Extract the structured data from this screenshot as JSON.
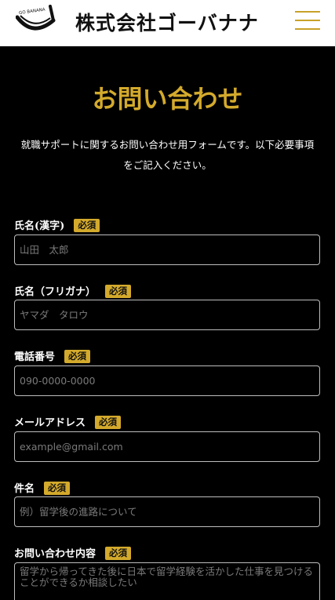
{
  "header": {
    "logo_arc_text": "GO BANANA",
    "logo_text": "株式会社ゴーバナナ",
    "menu_icon": "hamburger-icon",
    "accent_color": "#d4aa2c"
  },
  "page": {
    "title": "お問い合わせ",
    "intro": "就職サポートに関するお問い合わせ用フォームです。以下必要事項をご記入ください。"
  },
  "form": {
    "required_badge": "必須",
    "fields": [
      {
        "label": "氏名(漢字)",
        "placeholder": "山田　太郎"
      },
      {
        "label": "氏名（フリガナ）",
        "placeholder": "ヤマダ　タロウ"
      },
      {
        "label": "電話番号",
        "placeholder": "090-0000-0000"
      },
      {
        "label": "メールアドレス",
        "placeholder": "example@gmail.com"
      },
      {
        "label": "件名",
        "placeholder": "例）留学後の進路について"
      },
      {
        "label": "お問い合わせ内容",
        "placeholder": "留学から帰ってきた後に日本で留学経験を活かした仕事を見つけることができるか相談したい"
      }
    ]
  }
}
